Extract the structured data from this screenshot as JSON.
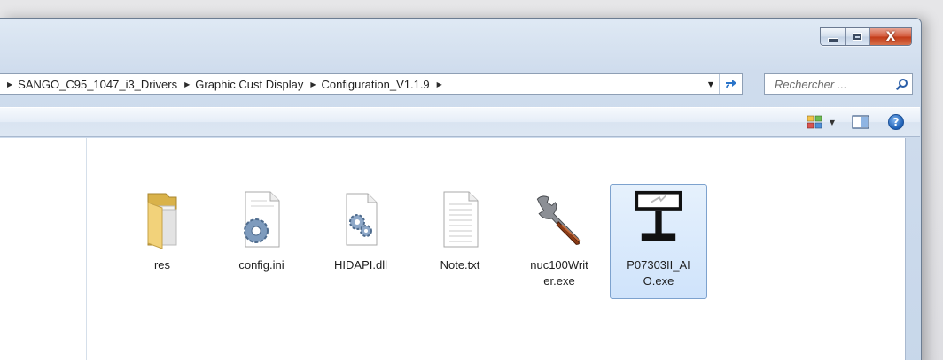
{
  "window": {
    "caption_buttons": {
      "minimize": "minimize",
      "maximize": "maximize",
      "close": "X"
    }
  },
  "address": {
    "breadcrumbs": [
      "SANGO_C95_1047_i3_Drivers",
      "Graphic Cust Display",
      "Configuration_V1.1.9"
    ],
    "separator": "▶",
    "dropdown": "▼",
    "refresh": "⇆"
  },
  "search": {
    "placeholder": "Rechercher ..."
  },
  "commandbar": {
    "views_arrow": "▼",
    "help": "?"
  },
  "files": [
    {
      "name": "res",
      "icon": "folder-icon",
      "selected": false
    },
    {
      "name": "config.ini",
      "icon": "settings-file-icon",
      "selected": false
    },
    {
      "name": "HIDAPI.dll",
      "icon": "dll-file-icon",
      "selected": false
    },
    {
      "name": "Note.txt",
      "icon": "text-file-icon",
      "selected": false
    },
    {
      "name": "nuc100Writ\ner.exe",
      "icon": "wrench-icon",
      "selected": false
    },
    {
      "name": "P07303II_AI\nO.exe",
      "icon": "display-device-icon",
      "selected": true
    }
  ],
  "colors": {
    "selection": "#cfe3fb",
    "selection_border": "#7da2ce",
    "close_button": "#c23a17",
    "folder": "#e8c96a"
  }
}
